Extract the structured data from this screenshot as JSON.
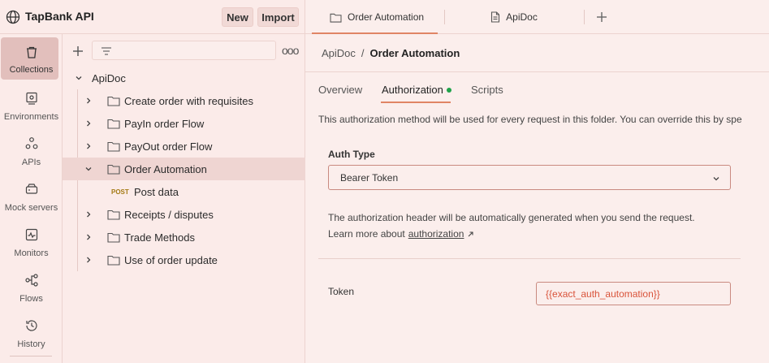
{
  "workspace": {
    "name": "TapBank API",
    "new_label": "New",
    "import_label": "Import"
  },
  "rail": {
    "items": [
      {
        "label": "Collections",
        "icon": "collections-icon",
        "active": true
      },
      {
        "label": "Environments",
        "icon": "environments-icon"
      },
      {
        "label": "APIs",
        "icon": "apis-icon"
      },
      {
        "label": "Mock servers",
        "icon": "mock-servers-icon"
      },
      {
        "label": "Monitors",
        "icon": "monitors-icon"
      },
      {
        "label": "Flows",
        "icon": "flows-icon"
      },
      {
        "label": "History",
        "icon": "history-icon"
      }
    ]
  },
  "tree": {
    "more_label": "ooo",
    "collection": "ApiDoc",
    "folders": [
      {
        "label": "Create order with requisites"
      },
      {
        "label": "PayIn order Flow"
      },
      {
        "label": "PayOut order Flow"
      },
      {
        "label": "Order Automation",
        "expanded": true,
        "selected": true
      },
      {
        "label": "Receipts / disputes"
      },
      {
        "label": "Trade Methods"
      },
      {
        "label": "Use of order update"
      }
    ],
    "request": {
      "method": "POST",
      "label": "Post data"
    }
  },
  "tabs": {
    "order_automation": "Order Automation",
    "apidoc": "ApiDoc"
  },
  "breadcrumb": {
    "parent": "ApiDoc",
    "separator": "/",
    "current": "Order Automation"
  },
  "subtabs": {
    "overview": "Overview",
    "authorization": "Authorization",
    "scripts": "Scripts"
  },
  "auth": {
    "description": "This authorization method will be used for every request in this folder. You can override this by spe",
    "type_label": "Auth Type",
    "type_value": "Bearer Token",
    "note_line1": "The authorization header will be automatically generated when you send the request.",
    "note_line2_prefix": "Learn more about",
    "note_link": "authorization",
    "token_label": "Token",
    "token_value": "{{exact_auth_automation}}"
  },
  "colors": {
    "accent": "#e08565",
    "active_dot": "#1fa34a",
    "token_text": "#d9533a",
    "method_post": "#a47a13"
  }
}
